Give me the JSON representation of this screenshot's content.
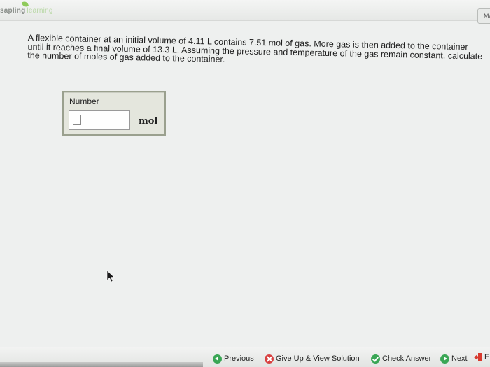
{
  "header": {
    "logo_sapling": "sapling",
    "logo_learning": "learning",
    "top_tab_label": "Ma"
  },
  "question": {
    "text": "A flexible container at an initial volume of 4.11 L contains 7.51 mol of gas. More gas is then added to the container until it reaches a final volume of 13.3 L. Assuming the pressure and temperature of the gas remain constant, calculate the number of moles of gas added to the container."
  },
  "answer": {
    "label": "Number",
    "value": "",
    "unit": "mol"
  },
  "footer": {
    "previous_label": "Previous",
    "giveup_label": "Give Up & View Solution",
    "check_label": "Check Answer",
    "next_label": "Next",
    "exit_label": "E"
  },
  "colors": {
    "accent_green": "#3aa655",
    "giveup_red": "#d84040",
    "exit_red": "#d83a2e"
  }
}
